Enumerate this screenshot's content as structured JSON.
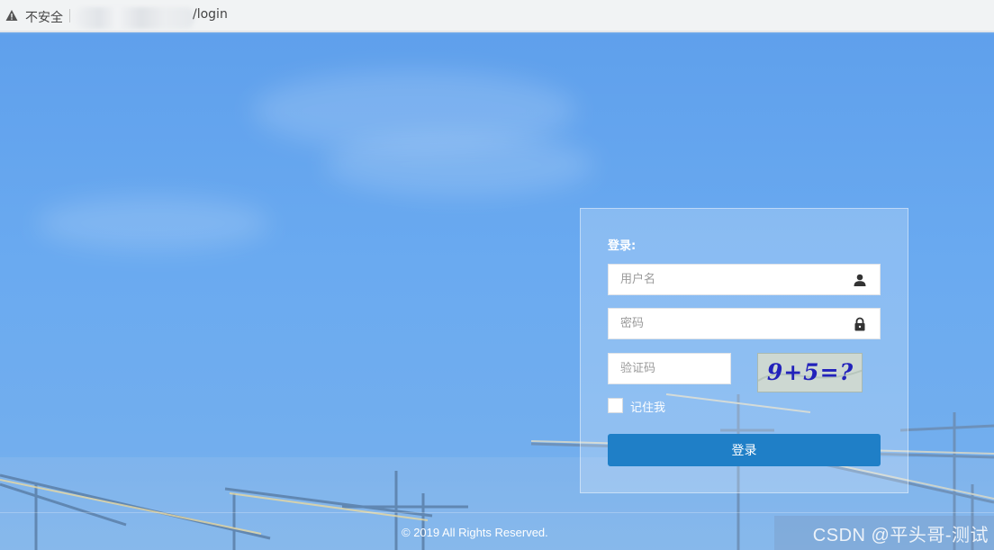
{
  "browser": {
    "security_label": "不安全",
    "url_path": "/login"
  },
  "login": {
    "title": "登录:",
    "username_placeholder": "用户名",
    "password_placeholder": "密码",
    "captcha_placeholder": "验证码",
    "captcha_text": "9+5=?",
    "remember_label": "记住我",
    "submit_label": "登录"
  },
  "footer": {
    "copyright": "© 2019 All Rights Reserved."
  },
  "watermark": "CSDN @平头哥-测试",
  "icons": {
    "address_warning": "warning-triangle-icon",
    "username": "user-icon",
    "password": "lock-icon"
  },
  "colors": {
    "login_button": "#1f7fc7",
    "background": "#6aa6ea"
  }
}
